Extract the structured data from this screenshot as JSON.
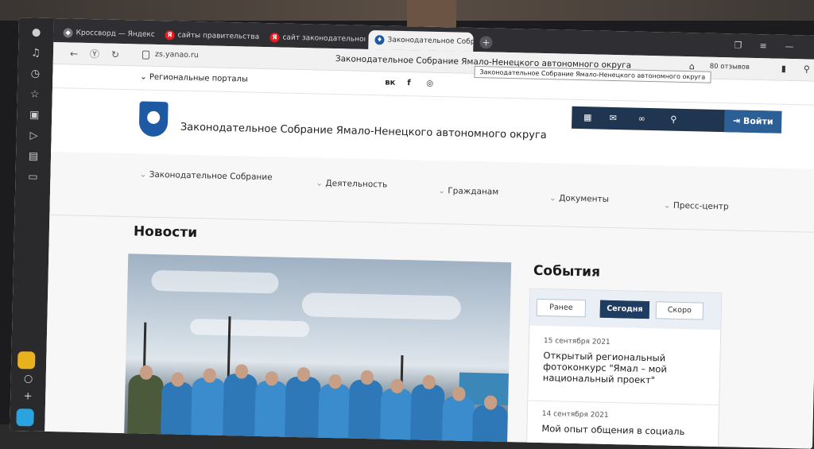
{
  "browser": {
    "tabs": [
      {
        "label": "Кроссворд — Яндекс.Игр",
        "favicon": "game"
      },
      {
        "label": "сайты правительства рф",
        "favicon": "Я"
      },
      {
        "label": "сайт законодательного с",
        "favicon": "Я"
      },
      {
        "label": "Законодательное Собр",
        "favicon": "emblem",
        "active": true
      }
    ],
    "tooltip": "Законодательное Собрание Ямало-Ненецкого автономного округа",
    "url": "zs.yanao.ru",
    "page_title": "Законодательное Собрание Ямало-Ненецкого автономного округа",
    "reviews": "80 отзывов"
  },
  "site": {
    "regional_portals": "Региональные порталы",
    "social": [
      "вк",
      "f",
      "◎"
    ],
    "name": "Законодательное Собрание Ямало-Ненецкого автономного округа",
    "login": "Войти",
    "menu": [
      "Законодательное Собрание",
      "Деятельность",
      "Гражданам",
      "Документы",
      "Пресс-центр"
    ],
    "news_heading": "Новости",
    "events_heading": "События",
    "event_tabs": [
      "Ранее",
      "Сегодня",
      "Скоро"
    ],
    "events": [
      {
        "date": "15 сентября 2021",
        "title": "Открытый региональный фотоконкурс \"Ямал – мой национальный проект\""
      },
      {
        "date": "14 сентября 2021",
        "title": "Мой опыт общения в социаль"
      }
    ]
  },
  "colors": {
    "accent": "#1f3d63",
    "login": "#2c5f95",
    "toolbar": "#1f3550"
  }
}
